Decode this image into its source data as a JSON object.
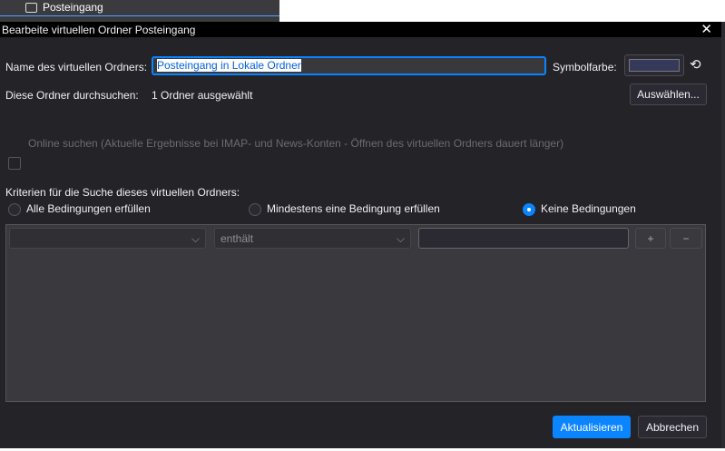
{
  "background": {
    "folder_label": "Posteingang"
  },
  "dialog": {
    "title": "Bearbeite virtuellen Ordner Posteingang",
    "name_label": "Name des virtuellen Ordners:",
    "name_value": "Posteingang in Lokale Ordner",
    "color_label": "Symbolfarbe:",
    "color_value": "#363a5a",
    "search_label": "Diese Ordner durchsuchen:",
    "search_value": "1 Ordner ausgewählt",
    "select_button": "Auswählen...",
    "online_label": "Online suchen (Aktuelle Ergebnisse bei IMAP- und News-Konten - Öffnen des virtuellen Ordners dauert länger)",
    "criteria_label": "Kriterien für die Suche dieses virtuellen Ordners:",
    "radios": [
      {
        "label": "Alle Bedingungen erfüllen",
        "checked": false
      },
      {
        "label": "Mindestens eine Bedingung erfüllen",
        "checked": false
      },
      {
        "label": "Keine Bedingungen",
        "checked": true
      }
    ],
    "rule": {
      "field": "",
      "operator": "enthält",
      "value": "",
      "add": "+",
      "remove": "−"
    },
    "update_button": "Aktualisieren",
    "cancel_button": "Abbrechen"
  }
}
